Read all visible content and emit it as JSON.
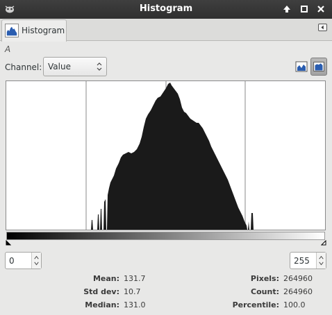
{
  "window": {
    "title": "Histogram"
  },
  "tab": {
    "label": "Histogram"
  },
  "layer": {
    "name": "A"
  },
  "channel": {
    "label": "Channel:",
    "value": "Value"
  },
  "range": {
    "low": "0",
    "high": "255"
  },
  "stats": {
    "mean_label": "Mean:",
    "mean": "131.7",
    "stddev_label": "Std dev:",
    "stddev": "10.7",
    "median_label": "Median:",
    "median": "131.0",
    "pixels_label": "Pixels:",
    "pixels": "264960",
    "count_label": "Count:",
    "count": "264960",
    "percentile_label": "Percentile:",
    "percentile": "100.0"
  },
  "colors": {
    "titlebar": "#333333",
    "histogram_fill": "#1a1a1a",
    "plot_bg": "#ffffff"
  },
  "chart_data": {
    "type": "bar",
    "x_range": [
      0,
      255
    ],
    "vertical_gridlines": 4,
    "grid": true,
    "series_shape_top": [
      [
        0,
        0
      ],
      [
        1,
        0
      ]
    ]
  }
}
